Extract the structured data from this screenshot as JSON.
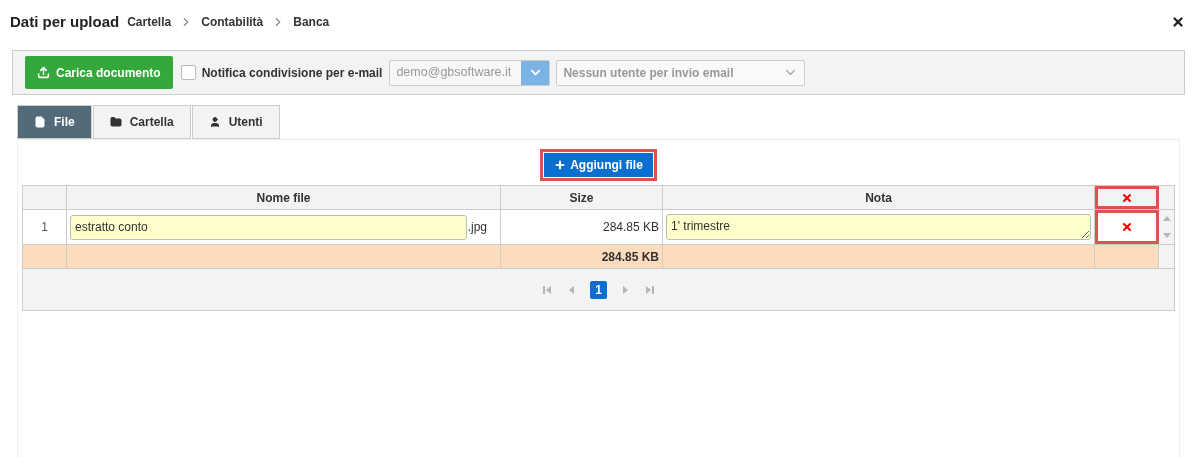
{
  "title": "Dati per upload",
  "breadcrumb": [
    "Cartella",
    "Contabilità",
    "Banca"
  ],
  "toolbar": {
    "upload_button": "Carica documento",
    "notify": {
      "label": "Notifica condivisione per e-mail",
      "checked": false
    },
    "sender_select": {
      "value": "demo@gbsoftware.it"
    },
    "users_select": {
      "placeholder": "Nessun utente per invio email"
    }
  },
  "tabs": [
    {
      "label": "File",
      "kind": "file",
      "selected": true
    },
    {
      "label": "Cartella",
      "kind": "folder",
      "selected": false
    },
    {
      "label": "Utenti",
      "kind": "user",
      "selected": false
    }
  ],
  "add_button": "Aggiungi file",
  "table": {
    "columns": [
      "Nome file",
      "Size",
      "Nota"
    ],
    "rows": [
      {
        "index": "1",
        "name": "estratto conto",
        "ext": ".jpg",
        "size": "284.85 KB",
        "note": "1' trimestre"
      }
    ],
    "footer": {
      "size_total": "284.85 KB"
    },
    "pager": {
      "pages": [
        {
          "label": "1",
          "selected": true
        }
      ]
    }
  }
}
